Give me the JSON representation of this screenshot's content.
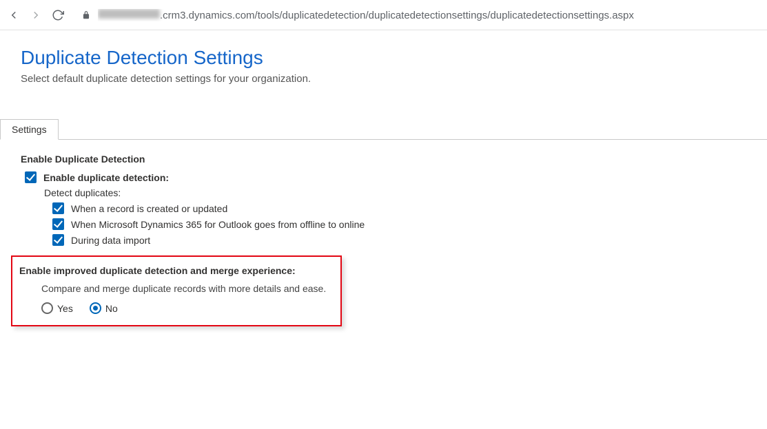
{
  "browser": {
    "url_domain_suffix": ".crm3.dynamics.com",
    "url_path": "/tools/duplicatedetection/duplicatedetectionsettings/duplicatedetectionsettings.aspx"
  },
  "header": {
    "title": "Duplicate Detection Settings",
    "subtitle": "Select default duplicate detection settings for your organization."
  },
  "tabs": {
    "active": "Settings"
  },
  "section_enable": {
    "heading": "Enable Duplicate Detection",
    "main_label": "Enable duplicate detection:",
    "main_checked": true,
    "detect_label": "Detect duplicates:",
    "options": [
      {
        "label": "When a record is created or updated",
        "checked": true
      },
      {
        "label": "When Microsoft Dynamics 365 for Outlook goes from offline to online",
        "checked": true
      },
      {
        "label": "During data import",
        "checked": true
      }
    ]
  },
  "section_improved": {
    "heading": "Enable improved duplicate detection and merge experience:",
    "description": "Compare and merge duplicate records with more details and ease.",
    "yes_label": "Yes",
    "no_label": "No",
    "selected": "no"
  }
}
